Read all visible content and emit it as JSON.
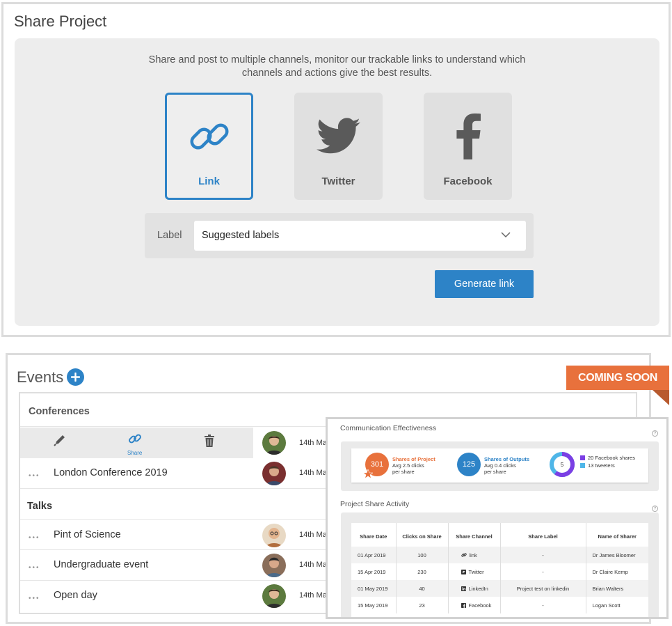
{
  "share_project": {
    "title": "Share Project",
    "description_line1": "Share and post to multiple channels, monitor our trackable links to understand which",
    "description_line2": "channels and actions give the best results.",
    "channels": [
      {
        "label": "Link",
        "icon": "link-icon",
        "selected": true
      },
      {
        "label": "Twitter",
        "icon": "twitter-icon",
        "selected": false
      },
      {
        "label": "Facebook",
        "icon": "facebook-icon",
        "selected": false
      }
    ],
    "label_field": {
      "label": "Label",
      "value": "Suggested labels"
    },
    "generate_button": "Generate link",
    "accent_color": "#2d83c7"
  },
  "events": {
    "title": "Events",
    "add_icon": "plus-icon",
    "coming_soon": "COMING SOON",
    "coming_soon_color": "#e8713c",
    "conferences": {
      "heading": "Conferences",
      "toolbar": {
        "edit_icon": "pen-icon",
        "share_icon": "link-icon",
        "share_label": "Share",
        "delete_icon": "trash-icon"
      },
      "toolbar_date": "14th Ma",
      "items": [
        {
          "name": "London Conference 2019",
          "date": "14th Ma"
        }
      ]
    },
    "talks": {
      "heading": "Talks",
      "items": [
        {
          "name": "Pint of Science",
          "date": "14th Ma"
        },
        {
          "name": "Undergraduate event",
          "date": "14th Ma"
        },
        {
          "name": "Open day",
          "date": "14th Ma"
        }
      ]
    }
  },
  "analytics": {
    "communication_title": "Communication Effectiveness",
    "stats": [
      {
        "value": "301",
        "title": "Shares of Project",
        "sub1": "Avg 2.5 clicks",
        "sub2": "per share",
        "color": "#e8713c"
      },
      {
        "value": "125",
        "title": "Shares of Outputs",
        "sub1": "Avg 0.4 clicks",
        "sub2": "per share",
        "color": "#2d83c7"
      }
    ],
    "donut": {
      "center": "5",
      "legend": [
        {
          "label": "20 Facebook shares",
          "color": "#7b3fe4"
        },
        {
          "label": "13 tweeters",
          "color": "#4fb6e8"
        }
      ]
    },
    "activity_title": "Project Share Activity",
    "table": {
      "headers": [
        "Share Date",
        "Clicks on Share",
        "Share Channel",
        "Share Label",
        "Name of Sharer"
      ],
      "rows": [
        {
          "date": "01 Apr 2019",
          "clicks": "100",
          "channel": "link",
          "channel_icon": "link-icon",
          "label": "-",
          "sharer": "Dr James Bloomer"
        },
        {
          "date": "15 Apr 2019",
          "clicks": "230",
          "channel": "Twitter",
          "channel_icon": "twitter-icon",
          "label": "-",
          "sharer": "Dr Claire Kemp"
        },
        {
          "date": "01 May 2019",
          "clicks": "40",
          "channel": "LinkedIn",
          "channel_icon": "linkedin-icon",
          "label": "Project test on linkedin",
          "sharer": "Brian Walters"
        },
        {
          "date": "15 May 2019",
          "clicks": "23",
          "channel": "Facebook",
          "channel_icon": "facebook-icon",
          "label": "-",
          "sharer": "Logan Scott"
        }
      ]
    }
  }
}
